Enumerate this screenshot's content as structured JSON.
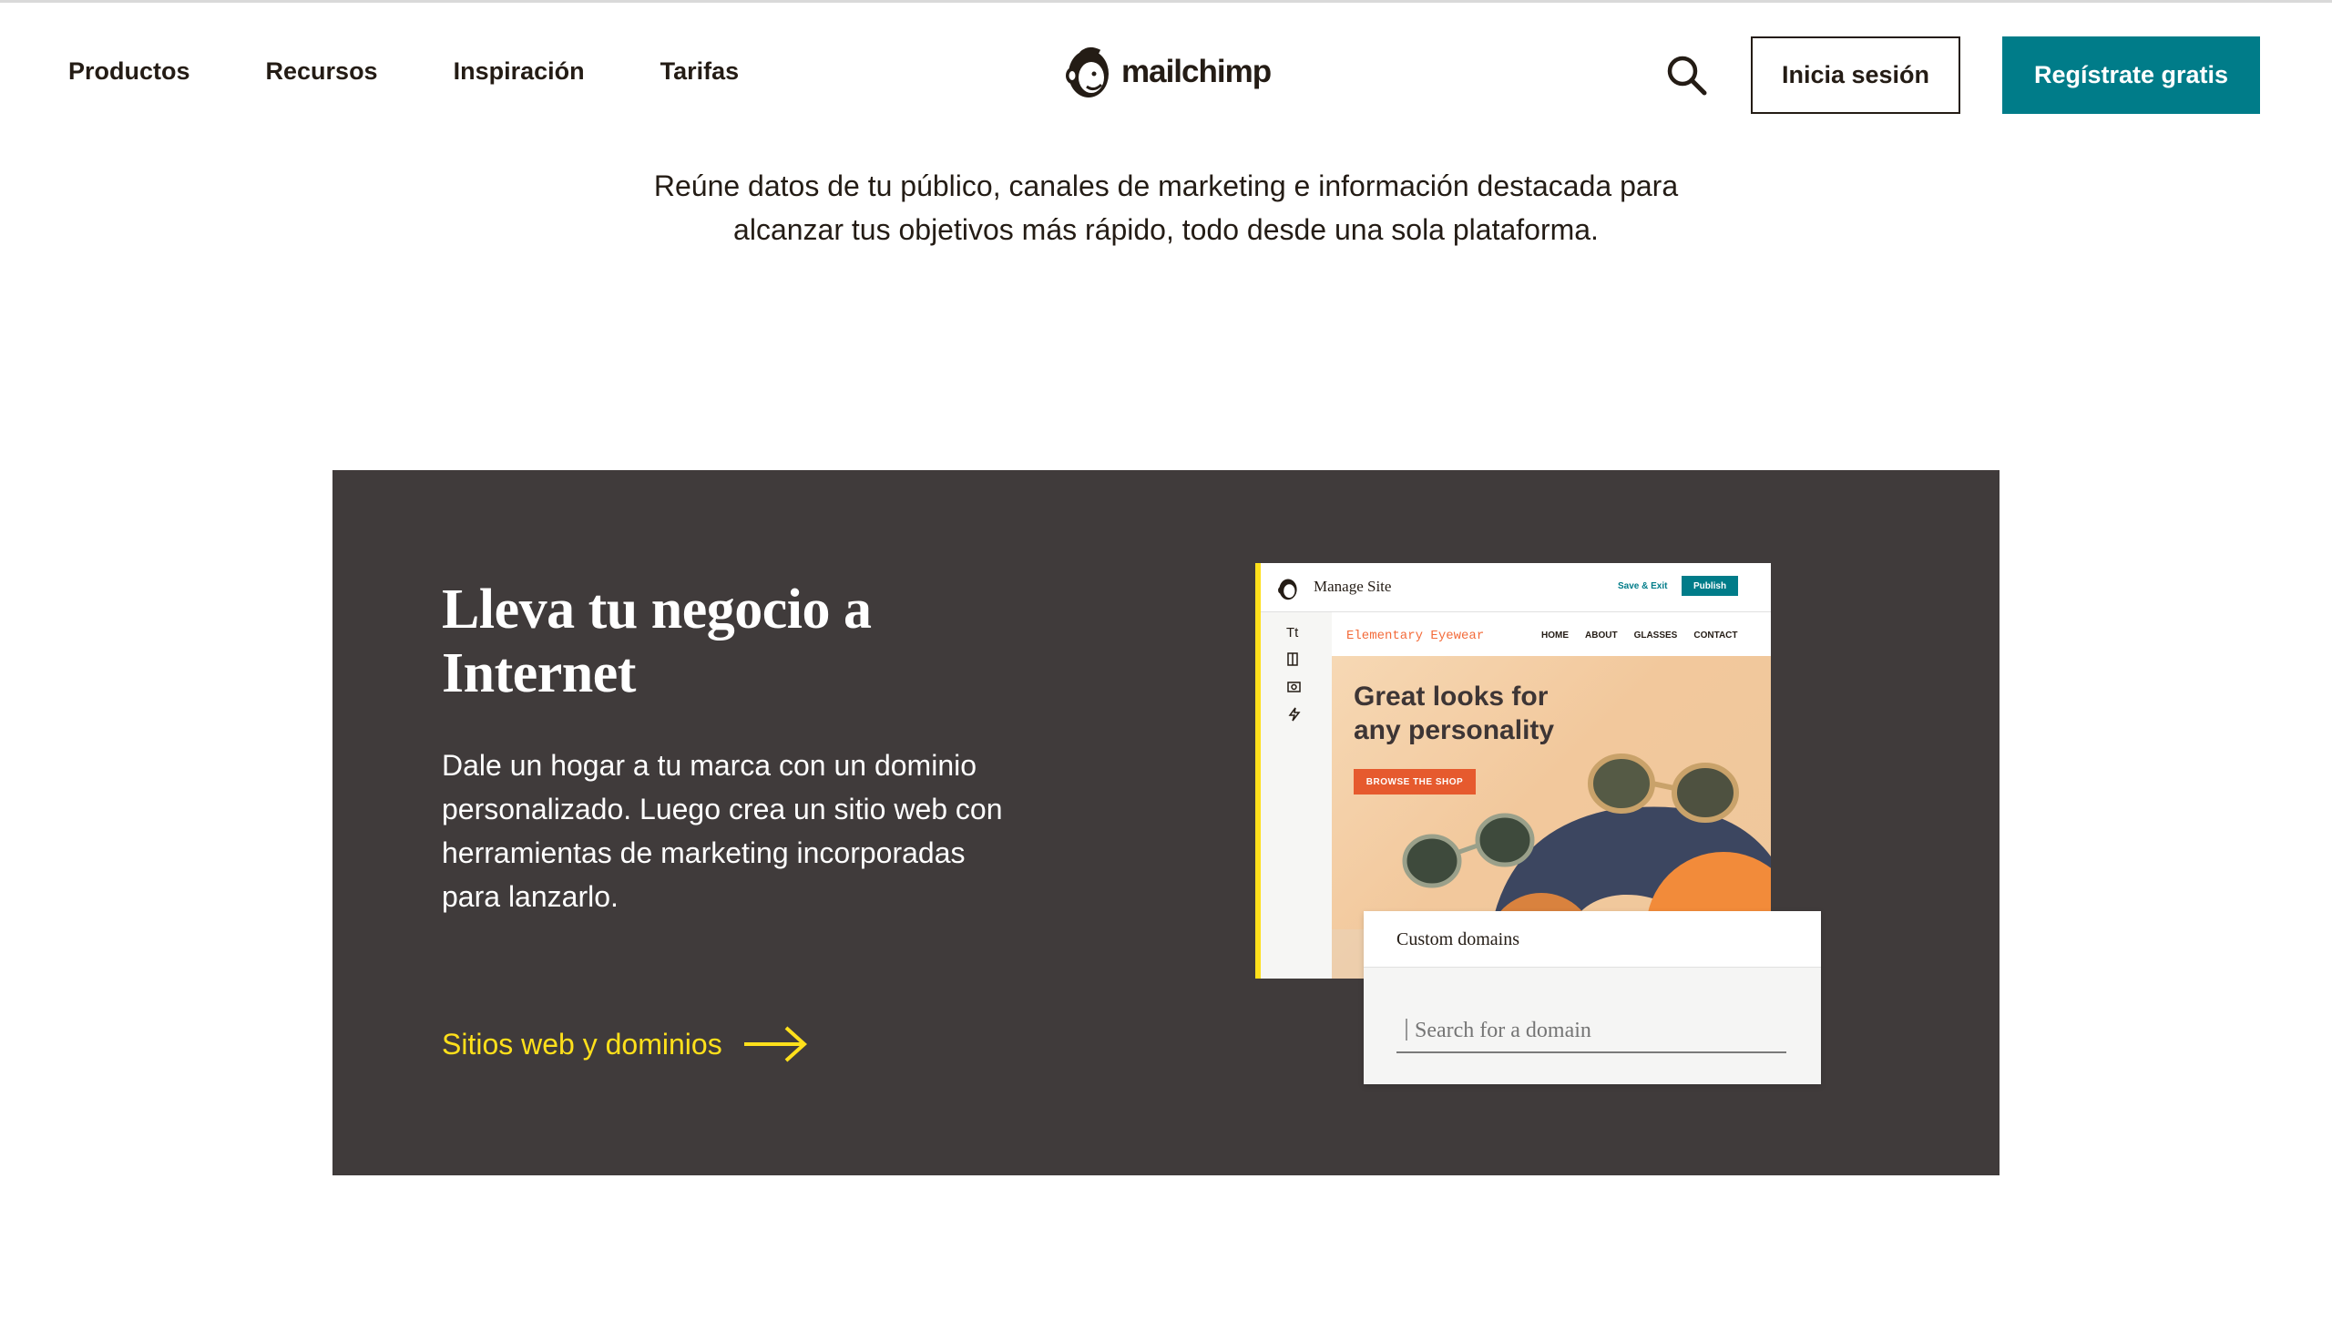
{
  "header": {
    "nav": [
      "Productos",
      "Recursos",
      "Inspiración",
      "Tarifas"
    ],
    "logo_text": "mailchimp",
    "login_label": "Inicia sesión",
    "signup_label": "Regístrate gratis"
  },
  "intro": {
    "line1": "Reúne datos de tu público, canales de marketing e información destacada para",
    "line2": "alcanzar tus objetivos más rápido, todo desde una sola plataforma."
  },
  "feature": {
    "title_line1": "Lleva tu negocio a",
    "title_line2": "Internet",
    "desc_line1": "Dale un hogar a tu marca con un dominio",
    "desc_line2": "personalizado. Luego crea un sitio web con",
    "desc_line3": "herramientas de marketing incorporadas",
    "desc_line4": "para lanzarlo.",
    "link_label": "Sitios web y dominios"
  },
  "mockup": {
    "manage_site": "Manage Site",
    "save_exit": "Save & Exit",
    "publish": "Publish",
    "tool_text": "Tt",
    "site_brand": "Elementary Eyewear",
    "site_links": [
      "HOME",
      "ABOUT",
      "GLASSES",
      "CONTACT"
    ],
    "hero_line1": "Great looks for",
    "hero_line2": "any personality",
    "hero_button": "BROWSE THE SHOP",
    "domains_title": "Custom domains",
    "domains_placeholder": "Search for a domain"
  },
  "colors": {
    "brand_teal": "#007c89",
    "feature_bg": "#403b3b",
    "accent_yellow": "#ffe01b",
    "hero_orange": "#e65a2e"
  },
  "icons": [
    "search-icon",
    "mailchimp-logo-icon",
    "arrow-right-icon",
    "text-tool-icon",
    "layout-tool-icon",
    "image-tool-icon",
    "bolt-tool-icon"
  ]
}
